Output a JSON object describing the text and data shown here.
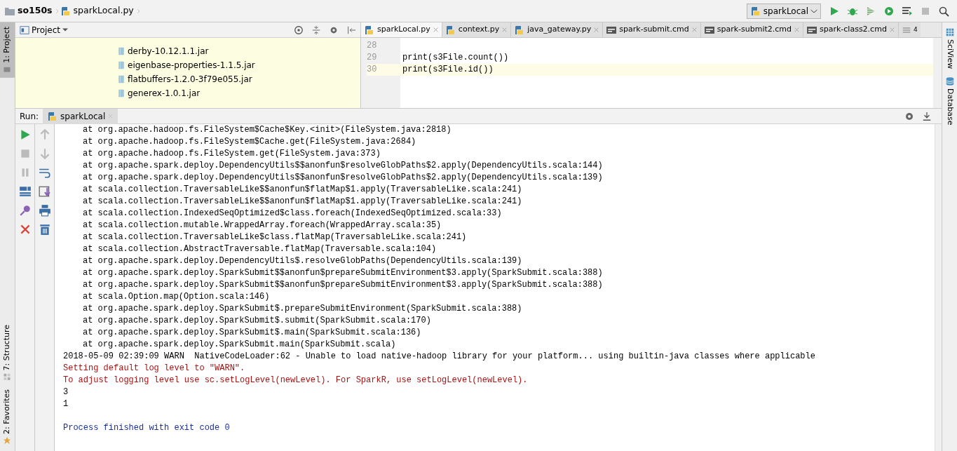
{
  "breadcrumb": [
    {
      "label": "so150s",
      "kind": "folder"
    },
    {
      "label": "sparkLocal.py",
      "kind": "python"
    }
  ],
  "run_config": {
    "label": "sparkLocal"
  },
  "left_stripe": [
    {
      "label": "1: Project",
      "selected": true,
      "kind": "project"
    },
    {
      "label": "7: Structure",
      "selected": false,
      "kind": "structure"
    },
    {
      "label": "2: Favorites",
      "selected": false,
      "kind": "favorites"
    }
  ],
  "right_stripe": [
    {
      "label": "SciView",
      "kind": "sciview"
    },
    {
      "label": "Database",
      "kind": "database"
    }
  ],
  "project_panel": {
    "title": "Project",
    "files": [
      "derby-10.12.1.1.jar",
      "eigenbase-properties-1.1.5.jar",
      "flatbuffers-1.2.0-3f79e055.jar",
      "generex-1.0.1.jar"
    ]
  },
  "editor_tabs": [
    {
      "label": "sparkLocal.py",
      "kind": "python",
      "selected": true
    },
    {
      "label": "context.py",
      "kind": "python",
      "selected": false
    },
    {
      "label": "java_gateway.py",
      "kind": "python",
      "selected": false
    },
    {
      "label": "spark-submit.cmd",
      "kind": "cmd",
      "selected": false
    },
    {
      "label": "spark-submit2.cmd",
      "kind": "cmd",
      "selected": false
    },
    {
      "label": "spark-class2.cmd",
      "kind": "cmd",
      "selected": false
    }
  ],
  "tab_overflow": "4",
  "editor_lines": [
    {
      "number": "28",
      "current": false
    },
    {
      "number": "29",
      "code": "print(s3File.count())",
      "current": false
    },
    {
      "number": "30",
      "code": "print(s3File.id())",
      "current": true
    }
  ],
  "run_panel": {
    "label": "Run:",
    "tab": "sparkLocal"
  },
  "console": [
    {
      "kind": "trace",
      "text": "at org.apache.hadoop.fs.FileSystem$Cache$Key.<init>(FileSystem.java:2818)"
    },
    {
      "kind": "trace",
      "text": "at org.apache.hadoop.fs.FileSystem$Cache.get(FileSystem.java:2684)"
    },
    {
      "kind": "trace",
      "text": "at org.apache.hadoop.fs.FileSystem.get(FileSystem.java:373)"
    },
    {
      "kind": "trace",
      "text": "at org.apache.spark.deploy.DependencyUtils$$anonfun$resolveGlobPaths$2.apply(DependencyUtils.scala:144)"
    },
    {
      "kind": "trace",
      "text": "at org.apache.spark.deploy.DependencyUtils$$anonfun$resolveGlobPaths$2.apply(DependencyUtils.scala:139)"
    },
    {
      "kind": "trace",
      "text": "at scala.collection.TraversableLike$$anonfun$flatMap$1.apply(TraversableLike.scala:241)"
    },
    {
      "kind": "trace",
      "text": "at scala.collection.TraversableLike$$anonfun$flatMap$1.apply(TraversableLike.scala:241)"
    },
    {
      "kind": "trace",
      "text": "at scala.collection.IndexedSeqOptimized$class.foreach(IndexedSeqOptimized.scala:33)"
    },
    {
      "kind": "trace",
      "text": "at scala.collection.mutable.WrappedArray.foreach(WrappedArray.scala:35)"
    },
    {
      "kind": "trace",
      "text": "at scala.collection.TraversableLike$class.flatMap(TraversableLike.scala:241)"
    },
    {
      "kind": "trace",
      "text": "at scala.collection.AbstractTraversable.flatMap(Traversable.scala:104)"
    },
    {
      "kind": "trace",
      "text": "at org.apache.spark.deploy.DependencyUtils$.resolveGlobPaths(DependencyUtils.scala:139)"
    },
    {
      "kind": "trace",
      "text": "at org.apache.spark.deploy.SparkSubmit$$anonfun$prepareSubmitEnvironment$3.apply(SparkSubmit.scala:388)"
    },
    {
      "kind": "trace",
      "text": "at org.apache.spark.deploy.SparkSubmit$$anonfun$prepareSubmitEnvironment$3.apply(SparkSubmit.scala:388)"
    },
    {
      "kind": "trace",
      "text": "at scala.Option.map(Option.scala:146)"
    },
    {
      "kind": "trace",
      "text": "at org.apache.spark.deploy.SparkSubmit$.prepareSubmitEnvironment(SparkSubmit.scala:388)"
    },
    {
      "kind": "trace",
      "text": "at org.apache.spark.deploy.SparkSubmit$.submit(SparkSubmit.scala:170)"
    },
    {
      "kind": "trace",
      "text": "at org.apache.spark.deploy.SparkSubmit$.main(SparkSubmit.scala:136)"
    },
    {
      "kind": "trace",
      "text": "at org.apache.spark.deploy.SparkSubmit.main(SparkSubmit.scala)"
    },
    {
      "kind": "plain",
      "text": "2018-05-09 02:39:09 WARN  NativeCodeLoader:62 - Unable to load native-hadoop library for your platform... using builtin-java classes where applicable"
    },
    {
      "kind": "stderr",
      "text": "Setting default log level to \"WARN\"."
    },
    {
      "kind": "stderr",
      "text": "To adjust logging level use sc.setLogLevel(newLevel). For SparkR, use setLogLevel(newLevel)."
    },
    {
      "kind": "plain",
      "text": "3"
    },
    {
      "kind": "plain",
      "text": "1"
    },
    {
      "kind": "blank"
    },
    {
      "kind": "exit",
      "text": "Process finished with exit code 0"
    }
  ]
}
